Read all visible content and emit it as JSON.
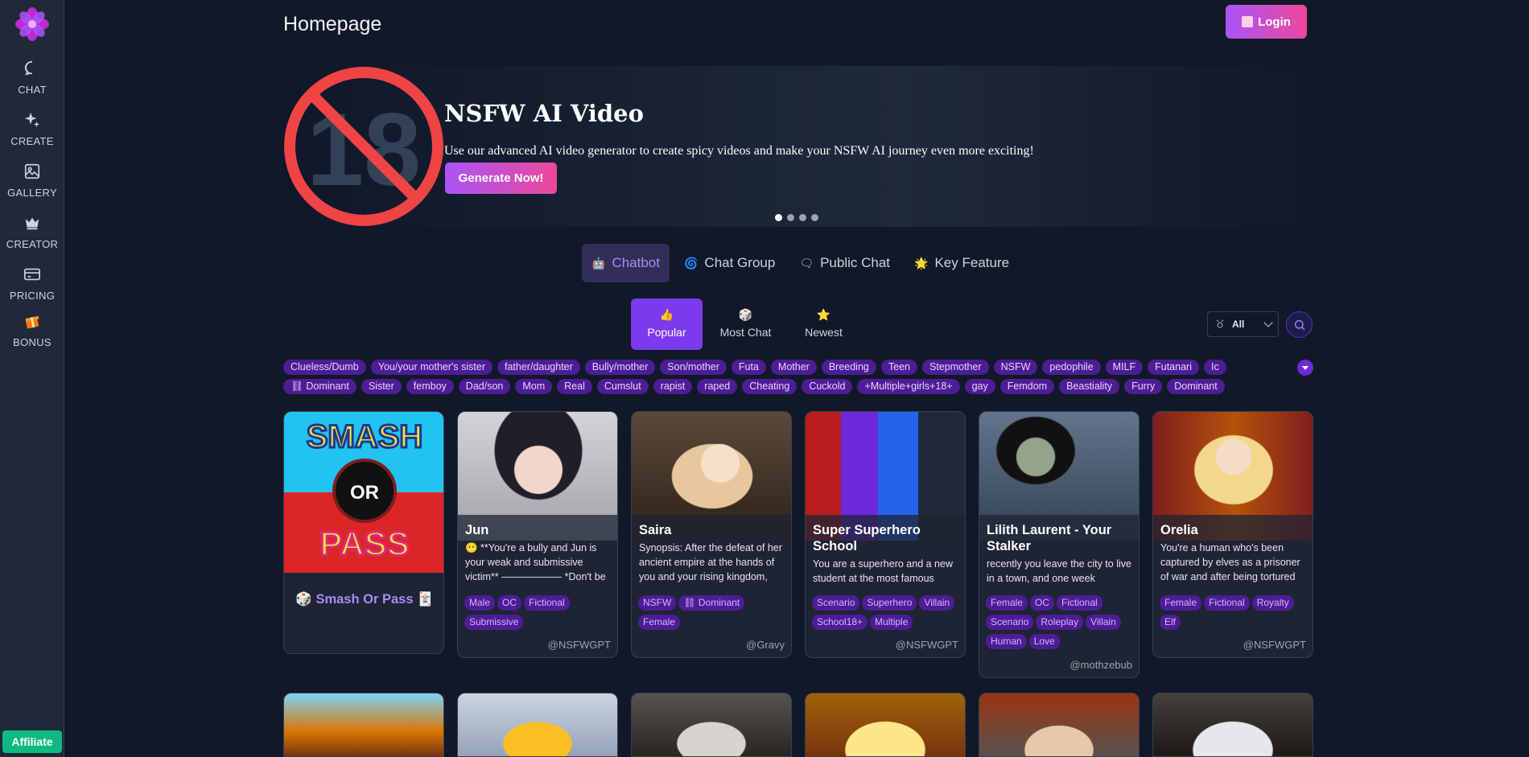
{
  "sidebar": {
    "items": [
      {
        "label": "CHAT",
        "icon": "chat-bubble-icon"
      },
      {
        "label": "CREATE",
        "icon": "sparkle-icon"
      },
      {
        "label": "GALLERY",
        "icon": "image-icon"
      },
      {
        "label": "CREATOR",
        "icon": "crown-icon"
      },
      {
        "label": "PRICING",
        "icon": "credit-card-icon"
      },
      {
        "label": "BONUS",
        "icon": "gift-icon"
      }
    ],
    "affiliate_label": "Affiliate"
  },
  "header": {
    "title": "Homepage",
    "login_label": "Login"
  },
  "banner": {
    "badge": "18",
    "title": "NSFW AI Video",
    "subtitle": "Use our advanced AI video generator to create spicy videos and make your NSFW AI journey even more exciting!",
    "cta": "Generate Now!",
    "slides": 4,
    "active_slide": 1
  },
  "main_tabs": [
    {
      "label": "Chatbot",
      "icon": "robot-icon",
      "active": true
    },
    {
      "label": "Chat Group",
      "icon": "chat-group-icon",
      "active": false
    },
    {
      "label": "Public Chat",
      "icon": "public-chat-icon",
      "active": false
    },
    {
      "label": "Key Feature",
      "icon": "star-icon",
      "active": false
    }
  ],
  "sub_tabs": [
    {
      "label": "Popular",
      "icon": "thumbs-up-icon",
      "active": true
    },
    {
      "label": "Most Chat",
      "icon": "chat-dice-icon",
      "active": false
    },
    {
      "label": "Newest",
      "icon": "star-icon",
      "active": false
    }
  ],
  "filter": {
    "value": "All"
  },
  "tags_row1": [
    "Clueless/Dumb",
    "You/your mother's sister",
    "father/daughter",
    "Bully/mother",
    "Son/mother",
    "Futa",
    "Mother",
    "Breeding",
    "Teen",
    "Stepmother",
    "NSFW",
    "pedophile",
    "MILF",
    "Futanari",
    "Ic"
  ],
  "tags_row2": [
    "⛓ Dominant",
    "Sister",
    "femboy",
    "Dad/son",
    "Mom",
    "Real",
    "Cumslut",
    "rapist",
    "raped",
    "Cheating",
    "Cuckold",
    "+Multiple+girls+18+",
    "gay",
    "Femdom",
    "Beastiality",
    "Furry",
    "Dominant"
  ],
  "featured": {
    "label": "🎲 Smash Or Pass 🃏",
    "image_text": [
      "SMASH",
      "OR",
      "PASS"
    ]
  },
  "cards": [
    {
      "name": "Jun",
      "desc": "😶 **You're a bully and Jun is your weak and submissive victim** —————— *Don't be",
      "tags": [
        "Male",
        "OC",
        "Fictional",
        "Submissive"
      ],
      "author": "@NSFWGPT"
    },
    {
      "name": "Saira",
      "desc": "Synopsis: After the defeat of her ancient empire at the hands of you and your rising kingdom,",
      "tags": [
        "NSFW",
        "⛓ Dominant",
        "Female"
      ],
      "author": "@Gravy"
    },
    {
      "name": "Super Superhero School",
      "desc": "You are a superhero and a new student at the most famous",
      "tags": [
        "Scenario",
        "Superhero",
        "Villain",
        "School18+",
        "Multiple"
      ],
      "author": "@NSFWGPT"
    },
    {
      "name": "Lilith Laurent - Your Stalker",
      "desc": "recently you leave the city to live in a town, and one week",
      "tags": [
        "Female",
        "OC",
        "Fictional",
        "Scenario",
        "Roleplay",
        "Villain",
        "Human",
        "Love"
      ],
      "author": "@mothzebub"
    },
    {
      "name": "Orelia",
      "desc": "You're a human who's been captured by elves as a prisoner of war and after being tortured",
      "tags": [
        "Female",
        "Fictional",
        "Royalty",
        "Elf"
      ],
      "author": "@NSFWGPT"
    }
  ]
}
